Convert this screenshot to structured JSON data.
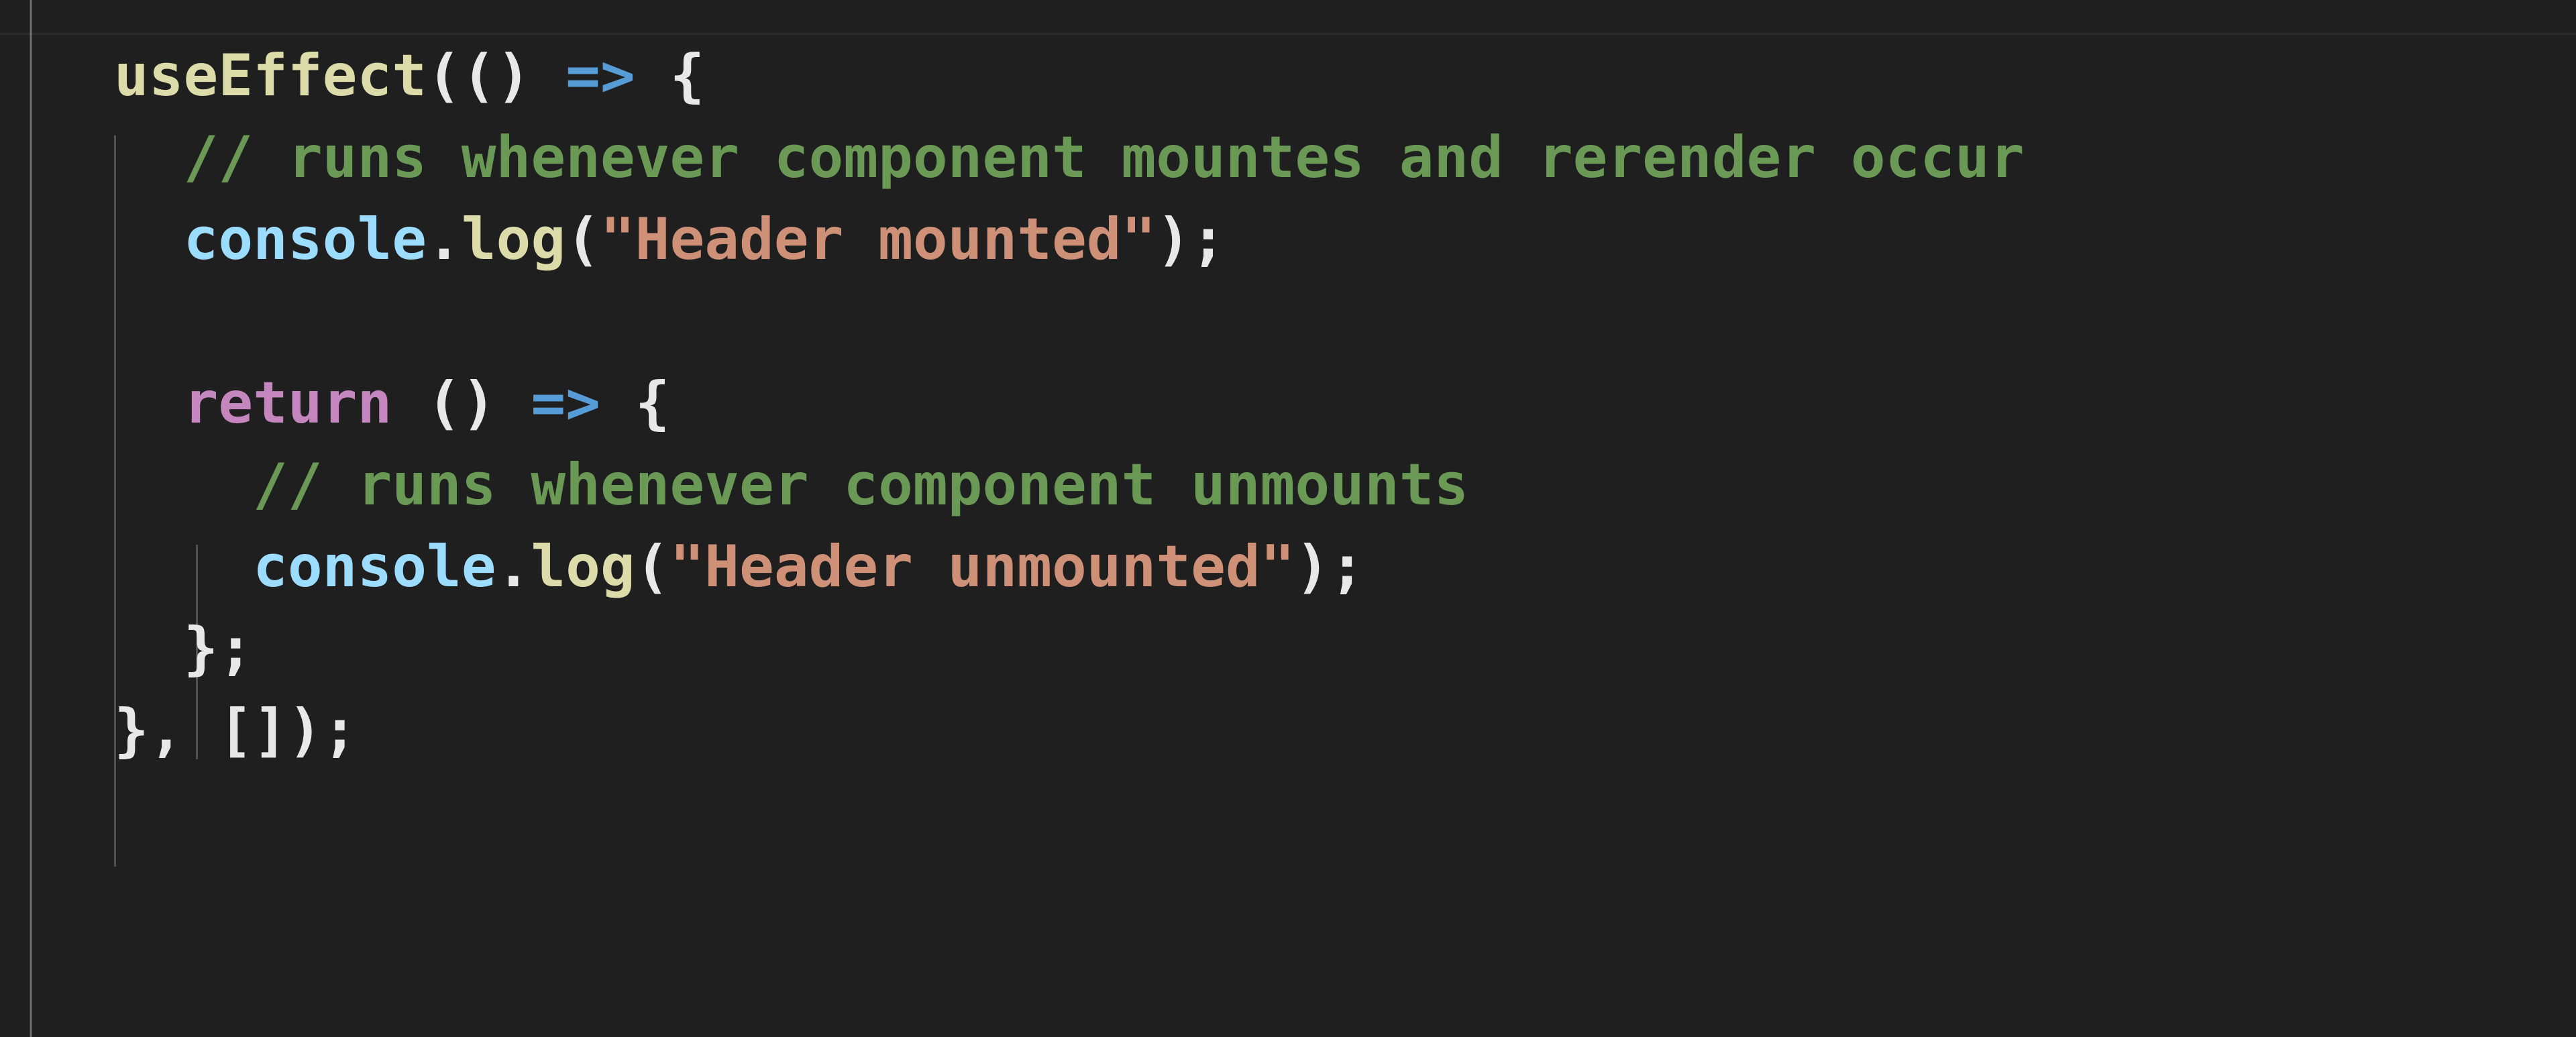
{
  "editor": {
    "theme_name": "dark-modern",
    "background_color": "#1F1F1F",
    "language": "javascript",
    "colors": {
      "background": "#1F1F1F",
      "foreground": "#D4D4D4",
      "function": "#DCDCAA",
      "variable": "#9CDCFE",
      "comment": "#6A9955",
      "string": "#CE9178",
      "keyword": "#C586C0",
      "operator": "#569CD6",
      "bracket": "#E8E8E8",
      "indent_guide": "#5A5A5A",
      "split_border": "#6E6E6E"
    }
  },
  "code": {
    "lines": [
      {
        "index": 1,
        "indent": 0,
        "plain": "useEffect(() => {",
        "tokens": [
          {
            "text": "useEffect",
            "kind": "func"
          },
          {
            "text": "(",
            "kind": "bracket-1"
          },
          {
            "text": "(",
            "kind": "bracket-2"
          },
          {
            "text": ")",
            "kind": "bracket-2"
          },
          {
            "text": " ",
            "kind": "plain"
          },
          {
            "text": "=>",
            "kind": "operator"
          },
          {
            "text": " ",
            "kind": "plain"
          },
          {
            "text": "{",
            "kind": "bracket-2"
          }
        ]
      },
      {
        "index": 2,
        "indent": 1,
        "plain": "  // runs whenever component mountes and rerender occur",
        "tokens": [
          {
            "text": "  ",
            "kind": "plain"
          },
          {
            "text": "// runs whenever component mountes and rerender occur",
            "kind": "comment"
          }
        ]
      },
      {
        "index": 3,
        "indent": 1,
        "plain": "  console.log(\"Header mounted\");",
        "tokens": [
          {
            "text": "  ",
            "kind": "plain"
          },
          {
            "text": "console",
            "kind": "var"
          },
          {
            "text": ".",
            "kind": "punct"
          },
          {
            "text": "log",
            "kind": "func"
          },
          {
            "text": "(",
            "kind": "bracket-1"
          },
          {
            "text": "\"Header mounted\"",
            "kind": "string"
          },
          {
            "text": ")",
            "kind": "bracket-1"
          },
          {
            "text": ";",
            "kind": "punct"
          }
        ]
      },
      {
        "index": 4,
        "indent": 1,
        "plain": "",
        "tokens": []
      },
      {
        "index": 5,
        "indent": 1,
        "plain": "  return () => {",
        "tokens": [
          {
            "text": "  ",
            "kind": "plain"
          },
          {
            "text": "return",
            "kind": "keyword"
          },
          {
            "text": " ",
            "kind": "plain"
          },
          {
            "text": "(",
            "kind": "bracket-1"
          },
          {
            "text": ")",
            "kind": "bracket-1"
          },
          {
            "text": " ",
            "kind": "plain"
          },
          {
            "text": "=>",
            "kind": "operator"
          },
          {
            "text": " ",
            "kind": "plain"
          },
          {
            "text": "{",
            "kind": "bracket-1"
          }
        ]
      },
      {
        "index": 6,
        "indent": 2,
        "plain": "    // runs whenever component unmounts",
        "tokens": [
          {
            "text": "    ",
            "kind": "plain"
          },
          {
            "text": "// runs whenever component unmounts",
            "kind": "comment"
          }
        ]
      },
      {
        "index": 7,
        "indent": 2,
        "plain": "    console.log(\"Header unmounted\");",
        "tokens": [
          {
            "text": "    ",
            "kind": "plain"
          },
          {
            "text": "console",
            "kind": "var"
          },
          {
            "text": ".",
            "kind": "punct"
          },
          {
            "text": "log",
            "kind": "func"
          },
          {
            "text": "(",
            "kind": "bracket-1"
          },
          {
            "text": "\"Header unmounted\"",
            "kind": "string"
          },
          {
            "text": ")",
            "kind": "bracket-1"
          },
          {
            "text": ";",
            "kind": "punct"
          }
        ]
      },
      {
        "index": 8,
        "indent": 1,
        "plain": "  };",
        "tokens": [
          {
            "text": "  ",
            "kind": "plain"
          },
          {
            "text": "}",
            "kind": "bracket-1"
          },
          {
            "text": ";",
            "kind": "punct"
          }
        ]
      },
      {
        "index": 9,
        "indent": 0,
        "plain": "}, []);",
        "tokens": [
          {
            "text": "}",
            "kind": "bracket-2"
          },
          {
            "text": ",",
            "kind": "punct"
          },
          {
            "text": " ",
            "kind": "plain"
          },
          {
            "text": "[",
            "kind": "bracket-2"
          },
          {
            "text": "]",
            "kind": "bracket-2"
          },
          {
            "text": ")",
            "kind": "bracket-1"
          },
          {
            "text": ";",
            "kind": "punct"
          }
        ]
      }
    ]
  }
}
